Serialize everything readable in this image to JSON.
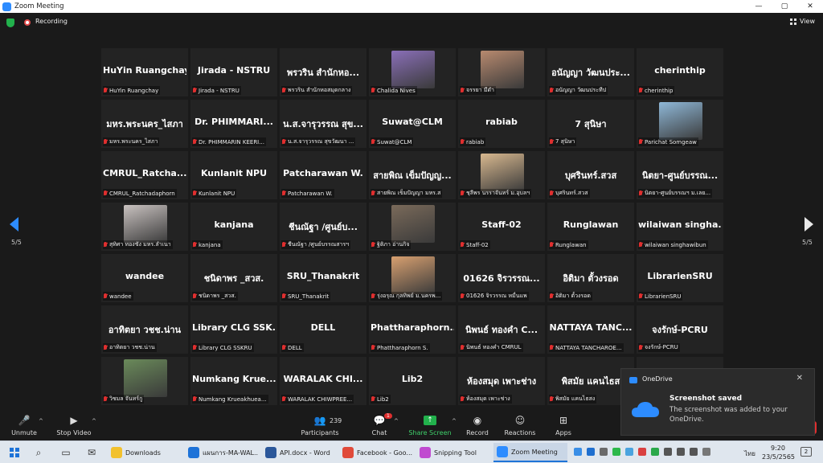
{
  "window": {
    "title": "Zoom Meeting",
    "controls": [
      "—",
      "▢",
      "✕"
    ]
  },
  "topbar": {
    "recording_label": "Recording",
    "view_label": "View"
  },
  "gallery": {
    "page_indicator": "5/5",
    "rows": [
      [
        {
          "name": "HuYin Ruangchay",
          "caption": "HuYin Ruangchay"
        },
        {
          "name": "Jirada - NSTRU",
          "caption": "Jirada - NSTRU"
        },
        {
          "name": "พรวริน สำนักหอ...",
          "caption": "พรวริน สำนักหอสมุดกลาง"
        },
        {
          "name": "",
          "caption": "Chalida Nives",
          "photo": "#8a6fb8"
        },
        {
          "name": "",
          "caption": "จรรยา มีดำ",
          "photo": "#b88a6f"
        },
        {
          "name": "อนัญญา วัฒนประ...",
          "caption": "อนัญญา วัฒนประทีป"
        },
        {
          "name": "cherinthip",
          "caption": "cherinthip"
        }
      ],
      [
        {
          "name": "มหร.พระนคร_ไสภา",
          "caption": "มหร.พระนคร_ไสภา"
        },
        {
          "name": "Dr. PHIMMARI...",
          "caption": "Dr. PHIMMARIN KEERI..."
        },
        {
          "name": "น.ส.จารุวรรณ สุข...",
          "caption": "น.ส.จารุวรรณ สุขวัฒนา ..."
        },
        {
          "name": "Suwat@CLM",
          "caption": "Suwat@CLM"
        },
        {
          "name": "rabiab",
          "caption": "rabiab"
        },
        {
          "name": "7 สุนิษา",
          "caption": "7 สุนิษา"
        },
        {
          "name": "",
          "caption": "Parichat Somgeaw",
          "photo": "#8fb8d8"
        }
      ],
      [
        {
          "name": "CMRUL_Ratcha...",
          "caption": "CMRUL_Ratchadaphorn"
        },
        {
          "name": "Kunlanit NPU",
          "caption": "Kunlanit NPU"
        },
        {
          "name": "Patcharawan W.",
          "caption": "Patcharawan W."
        },
        {
          "name": "สายพิณ เข็มปัญญ...",
          "caption": "สายพิณ เข็มปัญญา มหร.ส"
        },
        {
          "name": "",
          "caption": "ชุลีพร นรราจันทร์ ม.อุบลฯ",
          "photo": "#d8b88f"
        },
        {
          "name": "บุศรินทร์.สวส",
          "caption": "บุศรินทร์.สวส"
        },
        {
          "name": "นิตยา-ศูนย์บรรณ...",
          "caption": "นิตยา-ศูนย์บรรณฯ ม.เลย..."
        }
      ],
      [
        {
          "name": "",
          "caption": "สุทิศา ทองชัง มหร.ลำเนา",
          "photo": "#c9c2c0"
        },
        {
          "name": "kanjana",
          "caption": "kanjana"
        },
        {
          "name": "ชีนณัฐา /ศูนย์บ...",
          "caption": "ชีนณัฐา /ศูนย์บรรณสารฯ"
        },
        {
          "name": "",
          "caption": "ฐิติภา อ่านกิจ",
          "photo": "#7a6a5a"
        },
        {
          "name": "Staff-02",
          "caption": "Staff-02"
        },
        {
          "name": "Runglawan",
          "caption": "Runglawan"
        },
        {
          "name": "wilaiwan singha...",
          "caption": "wilaiwan singhawibun"
        }
      ],
      [
        {
          "name": "wandee",
          "caption": "wandee"
        },
        {
          "name": "ชนิดาพร _สวส.",
          "caption": "ชนิดาพร _สวส."
        },
        {
          "name": "SRU_Thanakrit",
          "caption": "SRU_Thanakrit"
        },
        {
          "name": "",
          "caption": "รุ่งอรุณ กุลทิพย์ ม.นครพ...",
          "photo": "#d8a070"
        },
        {
          "name": "01626 จิรวรรณ...",
          "caption": "01626 จิรวรรณ หมื่นแพ"
        },
        {
          "name": "อิติมา ตั้วงรอด",
          "caption": "อิติมา ตั้วงรอด"
        },
        {
          "name": "LibrarienSRU",
          "caption": "LibrarienSRU"
        }
      ],
      [
        {
          "name": "อาทิตยา วชช.น่าน",
          "caption": "อาทิตยา วชช.น่าน"
        },
        {
          "name": "Library CLG SSK...",
          "caption": "Library CLG SSKRU"
        },
        {
          "name": "DELL",
          "caption": "DELL"
        },
        {
          "name": "Phattharaphorn...",
          "caption": "Phattharaphorn S."
        },
        {
          "name": "นิพนธ์ ทองคำ C...",
          "caption": "นิพนธ์ ทองคำ CMRUL"
        },
        {
          "name": "NATTAYA TANC...",
          "caption": "NATTAYA TANCHAROE..."
        },
        {
          "name": "จงรักษ์-PCRU",
          "caption": "จงรักษ์-PCRU"
        }
      ],
      [
        {
          "name": "",
          "caption": "วิชมล จันทร์กู",
          "photo": "#6a8a5a"
        },
        {
          "name": "Numkang Krue...",
          "caption": "Numkang Krueakhuea..."
        },
        {
          "name": "WARALAK CHI...",
          "caption": "WARALAK CHIWPREE..."
        },
        {
          "name": "Lib2",
          "caption": "Lib2"
        },
        {
          "name": "ห้องสมุด เพาะช่าง",
          "caption": "ห้องสมุด เพาะช่าง"
        },
        {
          "name": "พิสมัย แคนไธส",
          "caption": "พิสมัย แคนไธสง"
        },
        {
          "name": "",
          "caption": ""
        }
      ]
    ]
  },
  "toolbar": {
    "unmute": "Unmute",
    "stop_video": "Stop Video",
    "participants": "Participants",
    "participants_count": "239",
    "chat": "Chat",
    "chat_badge": "1",
    "share_screen": "Share Screen",
    "record": "Record",
    "reactions": "Reactions",
    "apps": "Apps"
  },
  "toast": {
    "app": "OneDrive",
    "title": "Screenshot saved",
    "body": "The screenshot was added to your OneDrive."
  },
  "taskbar": {
    "apps": [
      {
        "label": "Downloads",
        "color": "#f2c12e"
      },
      {
        "label": "แผนการ-MA-WAL...",
        "color": "#1e73d8"
      },
      {
        "label": "API.docx - Word",
        "color": "#2b579a"
      },
      {
        "label": "Facebook - Goo...",
        "color": "#e04a3a"
      },
      {
        "label": "Snipping Tool",
        "color": "#c04ad0"
      },
      {
        "label": "Zoom Meeting",
        "color": "#2d8cff"
      }
    ],
    "language": "ไทย",
    "time": "9:20",
    "date": "23/5/2565",
    "notif_count": "2"
  },
  "colors": {
    "accent": "#2d8cff",
    "share_green": "#22b14c",
    "mute_red": "#e02f2f"
  }
}
